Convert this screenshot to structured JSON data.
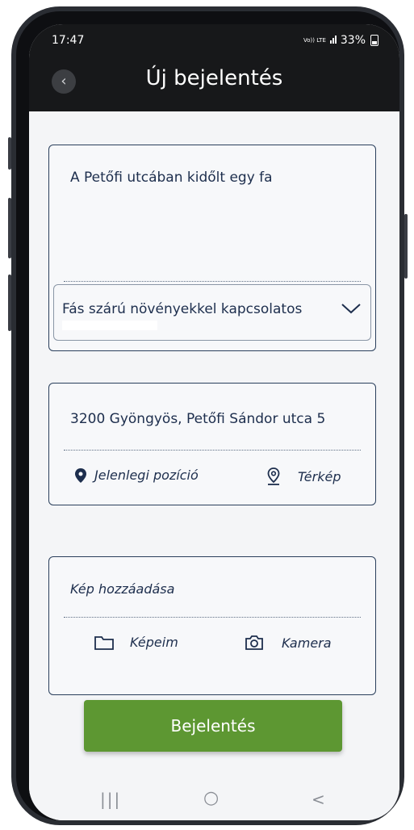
{
  "status": {
    "time": "17:47",
    "network": "Vo)) LTE",
    "battery": "33%"
  },
  "header": {
    "back_icon": "chevron-left-icon",
    "title": "Új bejelentés"
  },
  "description": {
    "text": "A Petőfi utcában kidőlt egy fa",
    "category": "Fás szárú növényekkel kapcsolatos",
    "category_icon": "chevron-down-icon"
  },
  "location": {
    "address": "3200 Gyöngyös, Petőfi Sándor utca 5",
    "current_position_label": "Jelenlegi pozíció",
    "map_label": "Térkép"
  },
  "picture": {
    "label": "Kép hozzáadása",
    "gallery_label": "Képeim",
    "camera_label": "Kamera"
  },
  "submit": {
    "label": "Bejelentés"
  },
  "navbar": {
    "recents": "|||",
    "home": "○",
    "back": "<"
  },
  "colors": {
    "header": "#17181a",
    "accent": "#5d9732",
    "text": "#1d2e4d"
  }
}
